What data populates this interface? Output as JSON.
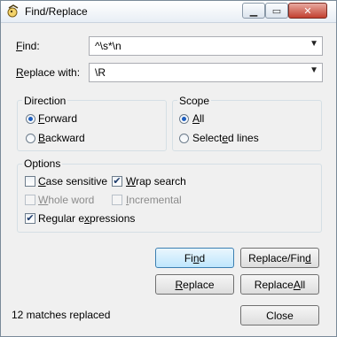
{
  "window": {
    "title": "Find/Replace",
    "controls": {
      "minimize_icon": "minimize-icon",
      "maximize_icon": "maximize-icon",
      "close_icon": "close-icon"
    }
  },
  "find": {
    "label_prefix": "",
    "label_underlined": "F",
    "label_rest": "ind:",
    "value": "^\\s*\\n"
  },
  "replace": {
    "label_prefix": "",
    "label_underlined": "R",
    "label_rest": "eplace with:",
    "value": "\\R"
  },
  "direction": {
    "title": "Direction",
    "forward": {
      "prefix": "",
      "underlined": "F",
      "rest": "orward",
      "selected": true
    },
    "backward": {
      "prefix": "",
      "underlined": "B",
      "rest": "ackward",
      "selected": false
    }
  },
  "scope": {
    "title": "Scope",
    "all": {
      "prefix": "",
      "underlined": "A",
      "rest": "ll",
      "selected": true
    },
    "selected_lines": {
      "prefix": "Select",
      "underlined": "e",
      "rest": "d lines",
      "selected": false
    }
  },
  "options": {
    "title": "Options",
    "case_sensitive": {
      "prefix": "",
      "underlined": "C",
      "rest": "ase sensitive",
      "checked": false,
      "enabled": true
    },
    "wrap_search": {
      "prefix": "",
      "underlined": "W",
      "rest": "rap search",
      "checked": true,
      "enabled": true
    },
    "whole_word": {
      "prefix": "",
      "underlined": "W",
      "rest": "hole word",
      "checked": false,
      "enabled": false
    },
    "incremental": {
      "prefix": "",
      "underlined": "I",
      "rest": "ncremental",
      "checked": false,
      "enabled": false
    },
    "regular_expressions": {
      "prefix": "Regular e",
      "underlined": "x",
      "rest": "pressions",
      "checked": true,
      "enabled": true
    }
  },
  "buttons": {
    "find": {
      "prefix": "Fi",
      "underlined": "n",
      "rest": "d"
    },
    "replace_find": {
      "prefix": "Replace/Fin",
      "underlined": "d",
      "rest": ""
    },
    "replace": {
      "prefix": "",
      "underlined": "R",
      "rest": "eplace"
    },
    "replace_all": {
      "prefix": "Replace ",
      "underlined": "A",
      "rest": "ll"
    },
    "close": {
      "label": "Close"
    }
  },
  "status": "12 matches replaced"
}
